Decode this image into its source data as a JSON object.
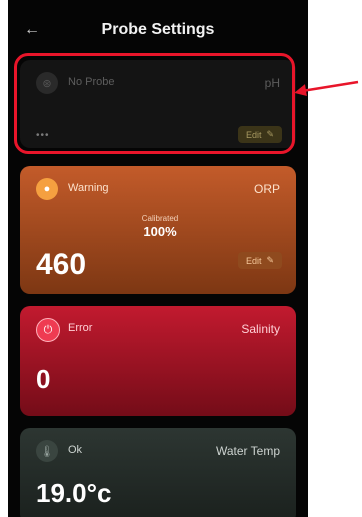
{
  "header": {
    "back_icon": "←",
    "title": "Probe Settings"
  },
  "probes": [
    {
      "status": "No Probe",
      "type": "pH",
      "value_dots": "•••",
      "subtext": "",
      "edit_label": "Edit",
      "icon": "probe-icon"
    },
    {
      "status": "Warning",
      "type": "ORP",
      "cal_label": "Calibrated",
      "cal_value": "100%",
      "value": "460",
      "subtext": "",
      "edit_label": "Edit",
      "icon": "warning-icon"
    },
    {
      "status": "Error",
      "type": "Salinity",
      "value": "0",
      "subtext": "",
      "icon": "error-icon"
    },
    {
      "status": "Ok",
      "type": "Water Temp",
      "value": "19.0°c",
      "subtext": "",
      "icon": "temperature-icon"
    }
  ],
  "colors": {
    "highlight": "#e8152a",
    "warning": "#c35b2a",
    "error": "#c21a2f",
    "ok": "#2d3632"
  }
}
